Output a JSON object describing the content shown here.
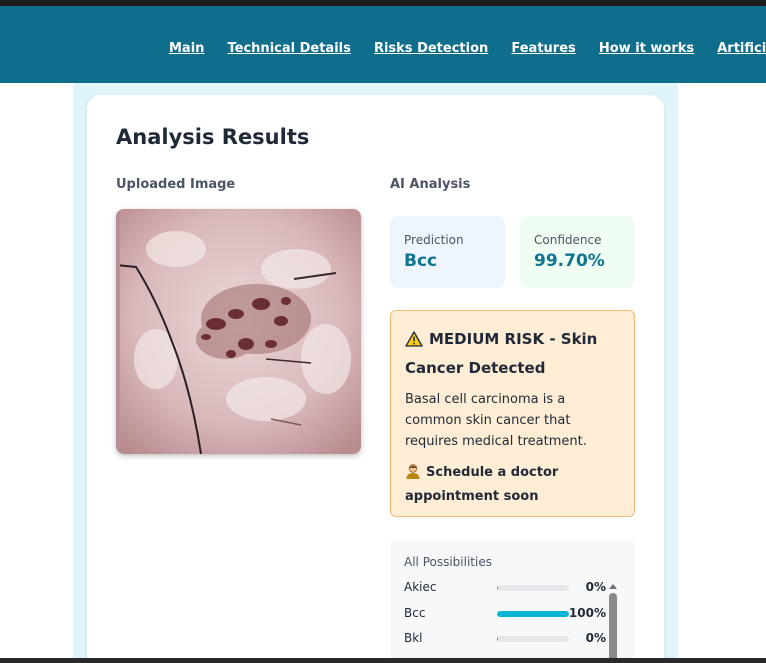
{
  "nav": {
    "links": [
      "Main",
      "Technical Details",
      "Risks Detection",
      "Features",
      "How it works",
      "Artificial Intelligence"
    ]
  },
  "analysis": {
    "title": "Analysis Results",
    "uploaded_label": "Uploaded Image",
    "ai_label": "AI Analysis",
    "prediction_label": "Prediction",
    "prediction_value": "Bcc",
    "confidence_label": "Confidence",
    "confidence_value": "99.70%"
  },
  "risk": {
    "icon": "warning-icon",
    "title": "MEDIUM RISK - Skin Cancer Detected",
    "description": "Basal cell carcinoma is a common skin cancer that requires medical treatment.",
    "action_icon": "doctor-icon",
    "action": "Schedule a doctor appointment soon"
  },
  "possibilities": {
    "title": "All Possibilities",
    "items": [
      {
        "name": "Akiec",
        "percent": "0%",
        "fraction": 0.0
      },
      {
        "name": "Bcc",
        "percent": "100%",
        "fraction": 1.0
      },
      {
        "name": "Bkl",
        "percent": "0%",
        "fraction": 0.0
      }
    ]
  },
  "colors": {
    "navbar": "#0f6e8c",
    "accent": "#0e7490",
    "bar": "#06b6d4",
    "risk_bg": "#ffedd5",
    "risk_border": "#f5b971"
  }
}
